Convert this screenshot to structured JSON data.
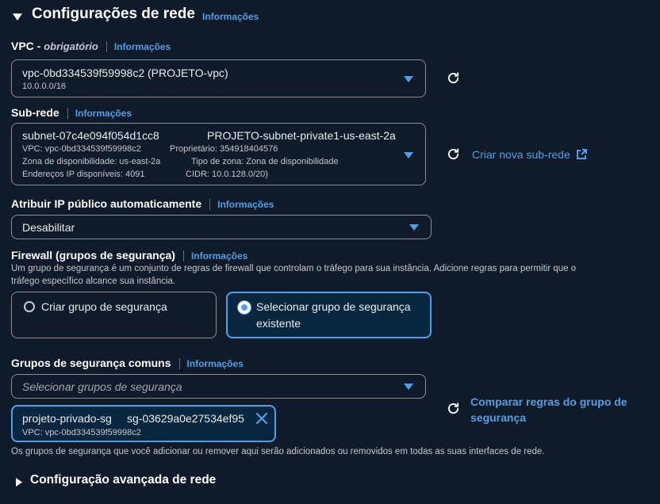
{
  "network": {
    "section_title": "Configurações de rede",
    "info_label": "Informações"
  },
  "vpc": {
    "label": "VPC - ",
    "required": "obrigatório",
    "info": "Informações",
    "selected": "vpc-0bd334539f59998c2 (PROJETO-vpc)",
    "cidr": "10.0.0.0/16"
  },
  "subnet": {
    "label": "Sub-rede",
    "info": "Informações",
    "id": "subnet-07c4e094f054d1cc8",
    "name": "PROJETO-subnet-private1-us-east-2a",
    "vpc": "VPC: vpc-0bd334539f59998c2",
    "owner": "Proprietário: 354918404576",
    "az": "Zona de disponibilidade: us-east-2a",
    "zone_type": "Tipo de zona: Zona de disponibilidade",
    "ips": "Endereços IP disponíveis: 4091",
    "cidr": "CIDR: 10.0.128.0/20)",
    "create_link": "Criar nova sub-rede"
  },
  "public_ip": {
    "label": "Atribuir IP público automaticamente",
    "info": "Informações",
    "selected": "Desabilitar"
  },
  "firewall": {
    "label": "Firewall (grupos de segurança)",
    "info": "Informações",
    "desc_line1": "Um grupo de segurança é um conjunto de regras de firewall que controlam o tráfego para sua instância. Adicione regras para permitir que o",
    "desc_line2": "tráfego específico alcance sua instância.",
    "option_create": "Criar grupo de segurança",
    "option_select_line1": "Selecionar grupo de segurança",
    "option_select_line2": "existente"
  },
  "common_sg": {
    "label": "Grupos de segurança comuns",
    "info": "Informações",
    "placeholder": "Selecionar grupos de segurança",
    "compare_line1": "Comparar regras do grupo de",
    "compare_line2": "segurança",
    "token_name": "projeto-privado-sg",
    "token_id": "sg-03629a0e27534ef95",
    "token_vpc": "VPC: vpc-0bd334539f59998c2",
    "footer_note": "Os grupos de segurança que você adicionar ou remover aqui serão adicionados ou removidos em todas as suas interfaces de rede."
  },
  "advanced": {
    "title": "Configuração avançada de rede"
  },
  "colors": {
    "background": "#0f1b2a",
    "accent": "#539fe5",
    "text": "#ffffff"
  }
}
